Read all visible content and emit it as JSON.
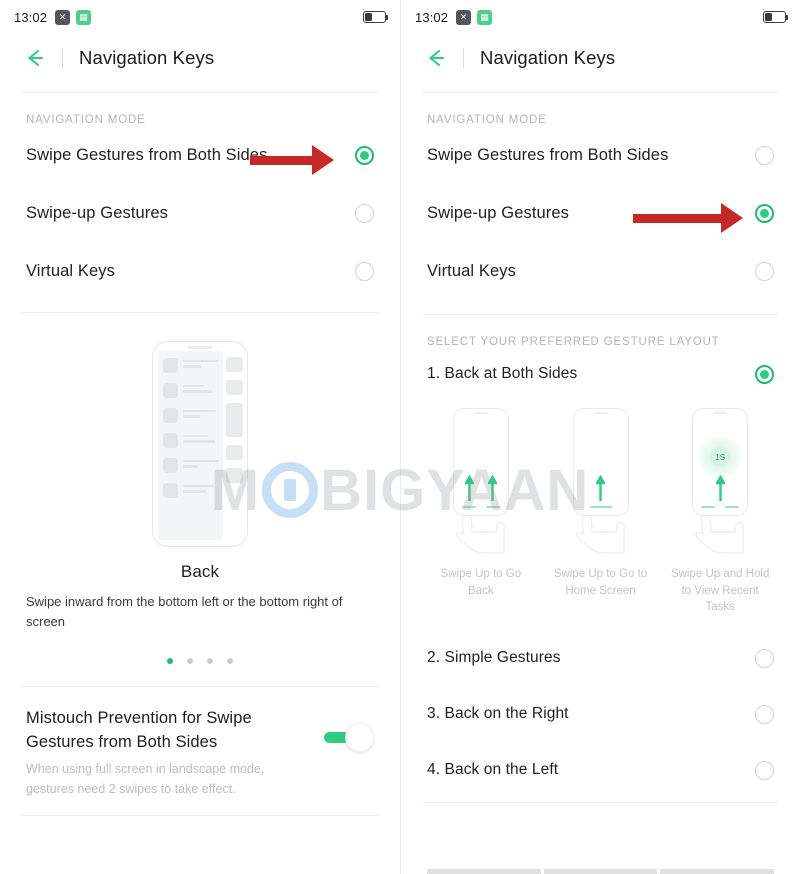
{
  "statusbar": {
    "time": "13:02",
    "icons": [
      "close-badge-icon",
      "calculator-icon"
    ],
    "battery_icon": "battery-low-icon"
  },
  "appbar": {
    "back_icon": "back-arrow-icon",
    "title": "Navigation Keys"
  },
  "watermark": {
    "before": "M",
    "logo": "O",
    "after": "BIGYAAN"
  },
  "left": {
    "section_label": "NAVIGATION MODE",
    "options": [
      {
        "label": "Swipe Gestures from Both Sides",
        "selected": true
      },
      {
        "label": "Swipe-up Gestures",
        "selected": false
      },
      {
        "label": "Virtual Keys",
        "selected": false
      }
    ],
    "illustration": {
      "name": "phone-back-gesture-illustration",
      "caption_title": "Back",
      "caption_desc": "Swipe inward from the bottom left or the bottom right of screen"
    },
    "pager": {
      "count": 4,
      "active_index": 0
    },
    "toggle": {
      "title": "Mistouch Prevention for Swipe Gestures from Both Sides",
      "subtitle": "When using full screen in landscape mode, gestures need 2 swipes to take effect.",
      "on": true
    }
  },
  "right": {
    "section_label": "NAVIGATION MODE",
    "options": [
      {
        "label": "Swipe Gestures from Both Sides",
        "selected": false
      },
      {
        "label": "Swipe-up Gestures",
        "selected": true
      },
      {
        "label": "Virtual Keys",
        "selected": false
      }
    ],
    "layout_section_label": "SELECT YOUR PREFERRED GESTURE LAYOUT",
    "layouts": [
      {
        "label": "1. Back at Both Sides",
        "selected": true
      },
      {
        "label": "2. Simple Gestures",
        "selected": false
      },
      {
        "label": "3. Back on the Right",
        "selected": false
      },
      {
        "label": "4. Back on the Left",
        "selected": false
      }
    ],
    "cards": [
      {
        "caption": "Swipe Up to Go Back",
        "arrows": 2,
        "badge": null
      },
      {
        "caption": "Swipe Up to Go to Home Screen",
        "arrows": 1,
        "badge": null
      },
      {
        "caption": "Swipe Up and Hold to View Recent Tasks",
        "arrows": 1,
        "badge": "1S"
      }
    ]
  },
  "colors": {
    "accent_green": "#2ecc82",
    "annotation_red": "#c62828",
    "muted_text": "#b4b4b4"
  }
}
